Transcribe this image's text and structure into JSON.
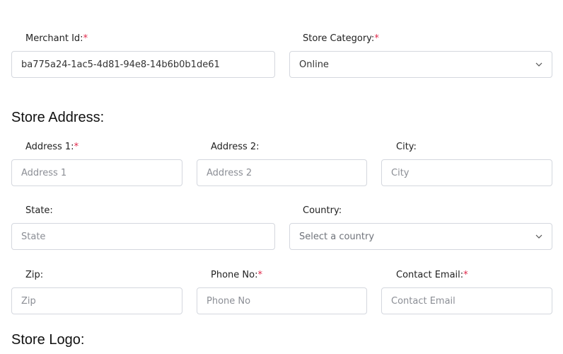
{
  "merchant": {
    "label": "Merchant Id:",
    "required_mark": "*",
    "value": "ba775a24-1ac5-4d81-94e8-14b6b0b1de61"
  },
  "category": {
    "label": "Store Category:",
    "required_mark": "*",
    "selected": "Online"
  },
  "address_section": {
    "title": "Store Address:"
  },
  "address1": {
    "label": "Address 1:",
    "required_mark": "*",
    "placeholder": "Address 1"
  },
  "address2": {
    "label": "Address 2:",
    "placeholder": "Address 2"
  },
  "city": {
    "label": "City:",
    "placeholder": "City"
  },
  "state": {
    "label": "State:",
    "placeholder": "State"
  },
  "country": {
    "label": "Country:",
    "selected": "Select a country"
  },
  "zip": {
    "label": "Zip:",
    "placeholder": "Zip"
  },
  "phone": {
    "label": "Phone No:",
    "required_mark": "*",
    "placeholder": "Phone No"
  },
  "email": {
    "label": "Contact Email:",
    "required_mark": "*",
    "placeholder": "Contact Email"
  },
  "logo_section": {
    "title": "Store Logo:"
  },
  "icons": {
    "dropdown": "chevron-down-icon"
  },
  "colors": {
    "required": "#e0284a",
    "border": "#d4d7de"
  }
}
